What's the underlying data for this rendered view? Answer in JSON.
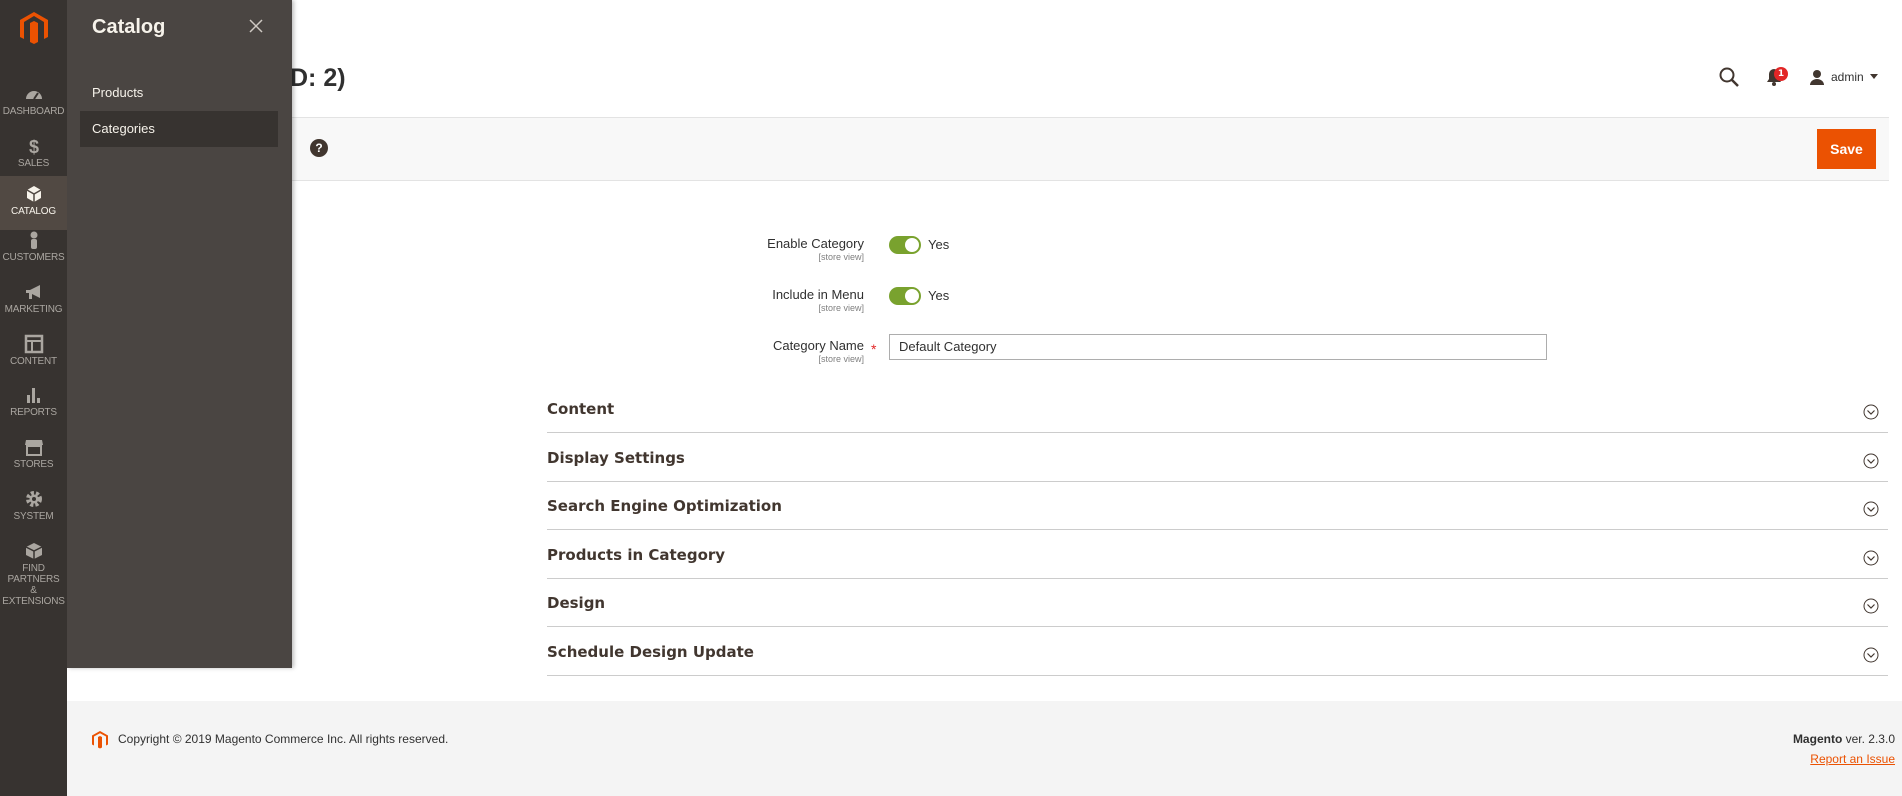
{
  "admin_menu": {
    "items": [
      {
        "label": "DASHBOARD",
        "icon": "dashboard-icon"
      },
      {
        "label": "SALES",
        "icon": "dollar-icon"
      },
      {
        "label": "CATALOG",
        "icon": "cube-icon",
        "active": true
      },
      {
        "label": "CUSTOMERS",
        "icon": "person-icon"
      },
      {
        "label": "MARKETING",
        "icon": "megaphone-icon"
      },
      {
        "label": "CONTENT",
        "icon": "layout-icon"
      },
      {
        "label": "REPORTS",
        "icon": "bar-chart-icon"
      },
      {
        "label": "STORES",
        "icon": "storefront-icon"
      },
      {
        "label": "SYSTEM",
        "icon": "gear-icon"
      },
      {
        "label_line1": "FIND PARTNERS",
        "label_line2": "& EXTENSIONS",
        "icon": "box-icon"
      }
    ]
  },
  "submenu": {
    "title": "Catalog",
    "links": [
      {
        "label": "Products"
      },
      {
        "label": "Categories",
        "active": true
      }
    ]
  },
  "header": {
    "page_title": "D: 2)",
    "user_name": "admin",
    "notification_count": "1"
  },
  "actions": {
    "help": "?",
    "save_label": "Save"
  },
  "form": {
    "enable_category": {
      "label": "Enable Category",
      "scope": "[store view]",
      "value": "Yes"
    },
    "include_in_menu": {
      "label": "Include in Menu",
      "scope": "[store view]",
      "value": "Yes"
    },
    "category_name": {
      "label": "Category Name",
      "scope": "[store view]",
      "required_mark": "*",
      "value": "Default Category"
    }
  },
  "sections": [
    {
      "title": "Content"
    },
    {
      "title": "Display Settings"
    },
    {
      "title": "Search Engine Optimization"
    },
    {
      "title": "Products in Category"
    },
    {
      "title": "Design"
    },
    {
      "title": "Schedule Design Update"
    }
  ],
  "footer": {
    "copyright": "Copyright © 2019 Magento Commerce Inc. All rights reserved.",
    "brand": "Magento",
    "version": "ver. 2.3.0",
    "report_issue": "Report an Issue"
  },
  "colors": {
    "menu_bg": "#373330",
    "submenu_bg": "#4a4542",
    "accent": "#eb5202",
    "toggle_on": "#79a22e",
    "badge": "#e22626"
  }
}
